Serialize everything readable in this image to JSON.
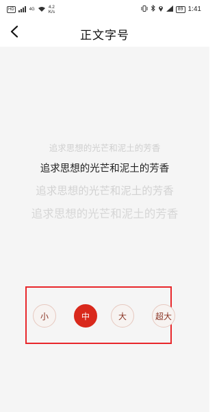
{
  "status_bar": {
    "network_type": "HD",
    "signal": "4G",
    "speed_value": "4.2",
    "speed_unit": "K/s",
    "battery": "89",
    "time": "1:41"
  },
  "header": {
    "title": "正文字号",
    "back_icon": "chevron-left-icon"
  },
  "preview": {
    "samples": [
      "追求思想的光芒和泥土的芳香",
      "追求思想的光芒和泥土的芳香",
      "追求思想的光芒和泥土的芳香",
      "追求思想的光芒和泥土的芳香"
    ]
  },
  "font_size": {
    "options": [
      "小",
      "中",
      "大",
      "超大"
    ],
    "selected": "中"
  },
  "colors": {
    "accent": "#d9291c",
    "frame": "#e8262a",
    "option_text": "#8a3424",
    "background": "#f5f5f5"
  }
}
